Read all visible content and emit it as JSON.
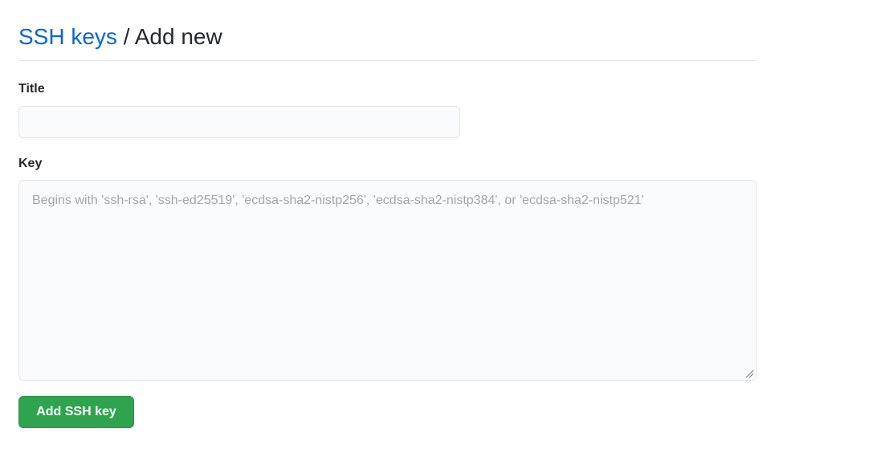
{
  "header": {
    "breadcrumb_link": "SSH keys",
    "separator": "/",
    "current": "Add new"
  },
  "form": {
    "title_label": "Title",
    "title_value": "",
    "title_placeholder": "",
    "key_label": "Key",
    "key_value": "",
    "key_placeholder": "Begins with 'ssh-rsa', 'ssh-ed25519', 'ecdsa-sha2-nistp256', 'ecdsa-sha2-nistp384', or 'ecdsa-sha2-nistp521'",
    "submit_label": "Add SSH key"
  },
  "colors": {
    "link": "#0366d6",
    "primary_button": "#2ea44f",
    "input_background": "#fafbfc",
    "border": "#e1e4e8"
  },
  "icons": {
    "resize_handle": "textarea-resize-grip-icon"
  }
}
